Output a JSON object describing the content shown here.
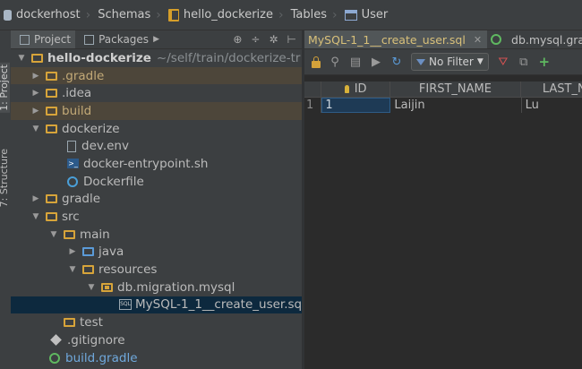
{
  "breadcrumbs": [
    {
      "label": "dockerhost",
      "icon": "database-icon"
    },
    {
      "label": "Schemas",
      "icon": ""
    },
    {
      "label": "hello_dockerize",
      "icon": "schema-icon"
    },
    {
      "label": "Tables",
      "icon": ""
    },
    {
      "label": "User",
      "icon": "table-icon"
    }
  ],
  "side_tabs": {
    "project": "1: Project",
    "structure": "7: Structure"
  },
  "project_panel": {
    "tabs": [
      "Project",
      "Packages"
    ],
    "tree": {
      "root": {
        "name": "hello-dockerize",
        "path": "~/self/train/dockerize-tr"
      },
      "gradle_dir": ".gradle",
      "idea_dir": ".idea",
      "build_dir": "build",
      "dockerize_dir": "dockerize",
      "dev_env": "dev.env",
      "entrypoint": "docker-entrypoint.sh",
      "dockerfile": "Dockerfile",
      "gradle_wrapper_dir": "gradle",
      "src_dir": "src",
      "main_dir": "main",
      "java_dir": "java",
      "resources_dir": "resources",
      "migration_pkg": "db.migration.mysql",
      "migration_file": "MySQL-1_1__create_user.sq",
      "test_dir": "test",
      "gitignore": ".gitignore",
      "build_gradle": "build.gradle"
    }
  },
  "editor": {
    "tabs": [
      {
        "label": "MySQL-1_1__create_user.sql",
        "active": true
      },
      {
        "label": "db.mysql.gradle",
        "active": false
      }
    ],
    "filter_label": "No Filter",
    "grid": {
      "columns": [
        "ID",
        "FIRST_NAME",
        "LAST_NA"
      ],
      "rows": [
        {
          "num": "1",
          "id": "1",
          "first_name": "Laijin",
          "last_name": "Lu"
        }
      ]
    }
  },
  "colors": {
    "background": "#2b2b2b",
    "panel": "#3c3f41",
    "selection": "#0d293e",
    "excluded": "#4d463a",
    "accent_folder": "#d7a43a"
  }
}
